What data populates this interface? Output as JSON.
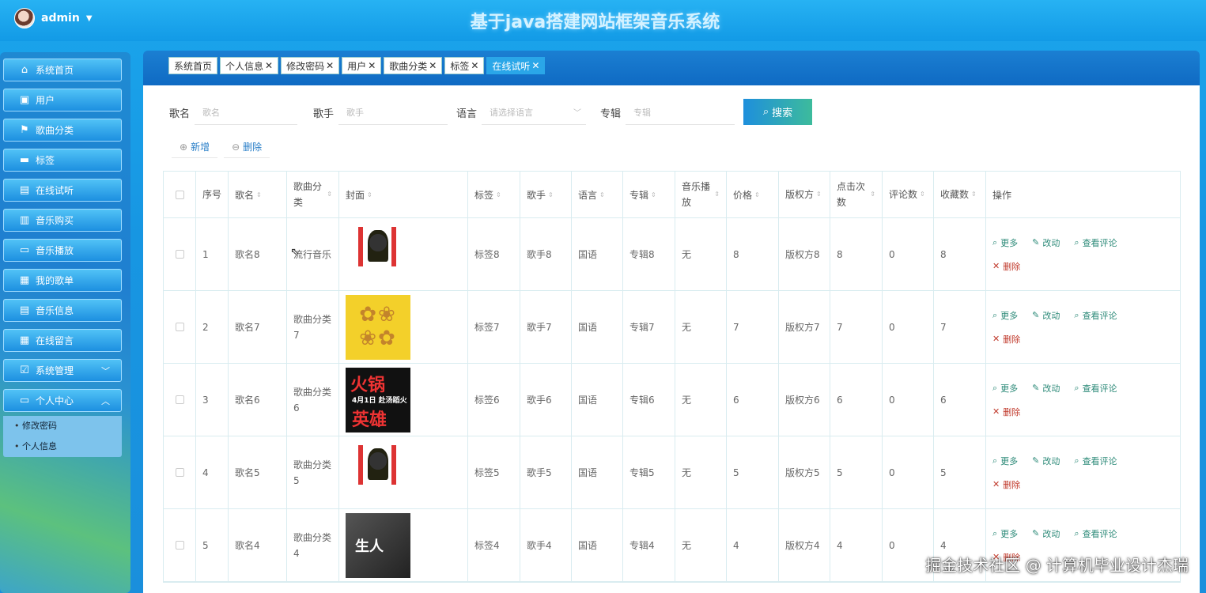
{
  "header": {
    "username": "admin",
    "site_title": "基于java搭建网站框架音乐系统"
  },
  "sidebar": {
    "items": [
      {
        "label": "系统首页",
        "icon": "home-icon"
      },
      {
        "label": "用户",
        "icon": "clipboard-icon"
      },
      {
        "label": "歌曲分类",
        "icon": "flag-icon"
      },
      {
        "label": "标签",
        "icon": "wallet-icon"
      },
      {
        "label": "在线试听",
        "icon": "briefcase-icon"
      },
      {
        "label": "音乐购买",
        "icon": "document-icon"
      },
      {
        "label": "音乐播放",
        "icon": "chat-icon"
      },
      {
        "label": "我的歌单",
        "icon": "grid-icon"
      },
      {
        "label": "音乐信息",
        "icon": "briefcase-icon"
      },
      {
        "label": "在线留言",
        "icon": "grid-icon"
      },
      {
        "label": "系统管理",
        "icon": "checklist-icon"
      },
      {
        "label": "个人中心",
        "icon": "window-icon"
      }
    ],
    "submenu": [
      "修改密码",
      "个人信息"
    ]
  },
  "tabs": [
    "系统首页",
    "个人信息",
    "修改密码",
    "用户",
    "歌曲分类",
    "标签",
    "在线试听"
  ],
  "search": {
    "song_label": "歌名",
    "song_placeholder": "歌名",
    "singer_label": "歌手",
    "singer_placeholder": "歌手",
    "lang_label": "语言",
    "lang_placeholder": "请选择语言",
    "album_label": "专辑",
    "album_placeholder": "专辑",
    "button": "搜索"
  },
  "actions": {
    "add": "新增",
    "delete": "删除"
  },
  "table": {
    "headers": [
      "序号",
      "歌名",
      "歌曲分类",
      "封面",
      "标签",
      "歌手",
      "语言",
      "专辑",
      "音乐播放",
      "价格",
      "版权方",
      "点击次数",
      "评论数",
      "收藏数",
      "操作"
    ],
    "ops": {
      "more": "更多",
      "edit": "改动",
      "comments": "查看评论",
      "delete": "删除"
    },
    "rows": [
      {
        "no": "1",
        "name": "歌名8",
        "category": "流行音乐",
        "tag": "标签8",
        "singer": "歌手8",
        "lang": "国语",
        "album": "专辑8",
        "play": "无",
        "price": "8",
        "copyright": "版权方8",
        "clicks": "8",
        "comments": "0",
        "favs": "8"
      },
      {
        "no": "2",
        "name": "歌名7",
        "category": "歌曲分类7",
        "tag": "标签7",
        "singer": "歌手7",
        "lang": "国语",
        "album": "专辑7",
        "play": "无",
        "price": "7",
        "copyright": "版权方7",
        "clicks": "7",
        "comments": "0",
        "favs": "7"
      },
      {
        "no": "3",
        "name": "歌名6",
        "category": "歌曲分类6",
        "tag": "标签6",
        "singer": "歌手6",
        "lang": "国语",
        "album": "专辑6",
        "play": "无",
        "price": "6",
        "copyright": "版权方6",
        "clicks": "6",
        "comments": "0",
        "favs": "6"
      },
      {
        "no": "4",
        "name": "歌名5",
        "category": "歌曲分类5",
        "tag": "标签5",
        "singer": "歌手5",
        "lang": "国语",
        "album": "专辑5",
        "play": "无",
        "price": "5",
        "copyright": "版权方5",
        "clicks": "5",
        "comments": "0",
        "favs": "5"
      },
      {
        "no": "5",
        "name": "歌名4",
        "category": "歌曲分类4",
        "tag": "标签4",
        "singer": "歌手4",
        "lang": "国语",
        "album": "专辑4",
        "play": "无",
        "price": "4",
        "copyright": "版权方4",
        "clicks": "4",
        "comments": "0",
        "favs": "4"
      }
    ]
  },
  "covers": {
    "c3_text1": "火锅",
    "c3_text2": "4月1日 赴汤蹈火",
    "c3_text3": "英雄",
    "c4_text": "生人"
  },
  "watermark": "掘金技术社区 @ 计算机毕业设计杰瑞"
}
